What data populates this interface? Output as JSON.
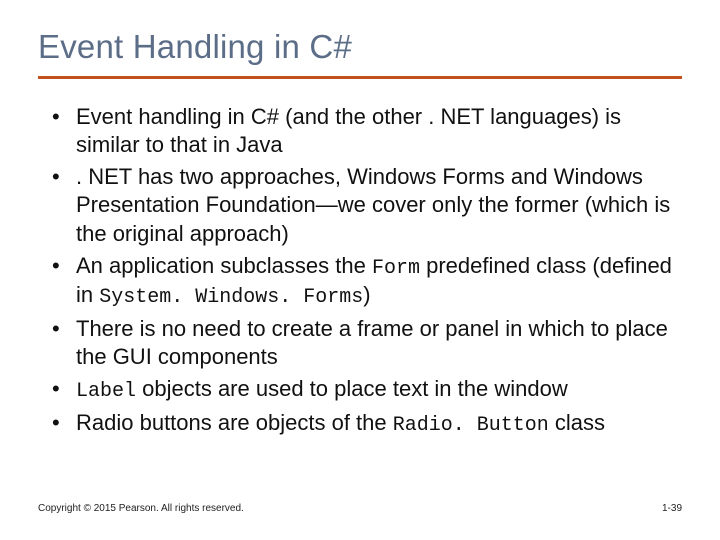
{
  "title": "Event Handling in C#",
  "bullets": [
    {
      "pre": "Event handling in C# (and the other . NET languages) is similar to that in Java"
    },
    {
      "pre": ". NET has two approaches, Windows Forms and Windows Presentation Foundation—we cover only the former (which is the original approach)"
    },
    {
      "pre": "An application subclasses the ",
      "code": "Form",
      "post": " predefined class (defined in ",
      "code2": "System. Windows. Forms",
      "post2": ")"
    },
    {
      "pre": "There is no need to create a frame or panel in which to place the GUI components"
    },
    {
      "code0": "Label",
      "pre": " objects are used to place text in the window"
    },
    {
      "pre": "Radio buttons are objects of the ",
      "code": "Radio. Button",
      "post": " class"
    }
  ],
  "footer": "Copyright © 2015 Pearson. All rights reserved.",
  "pagenum": "1-39"
}
